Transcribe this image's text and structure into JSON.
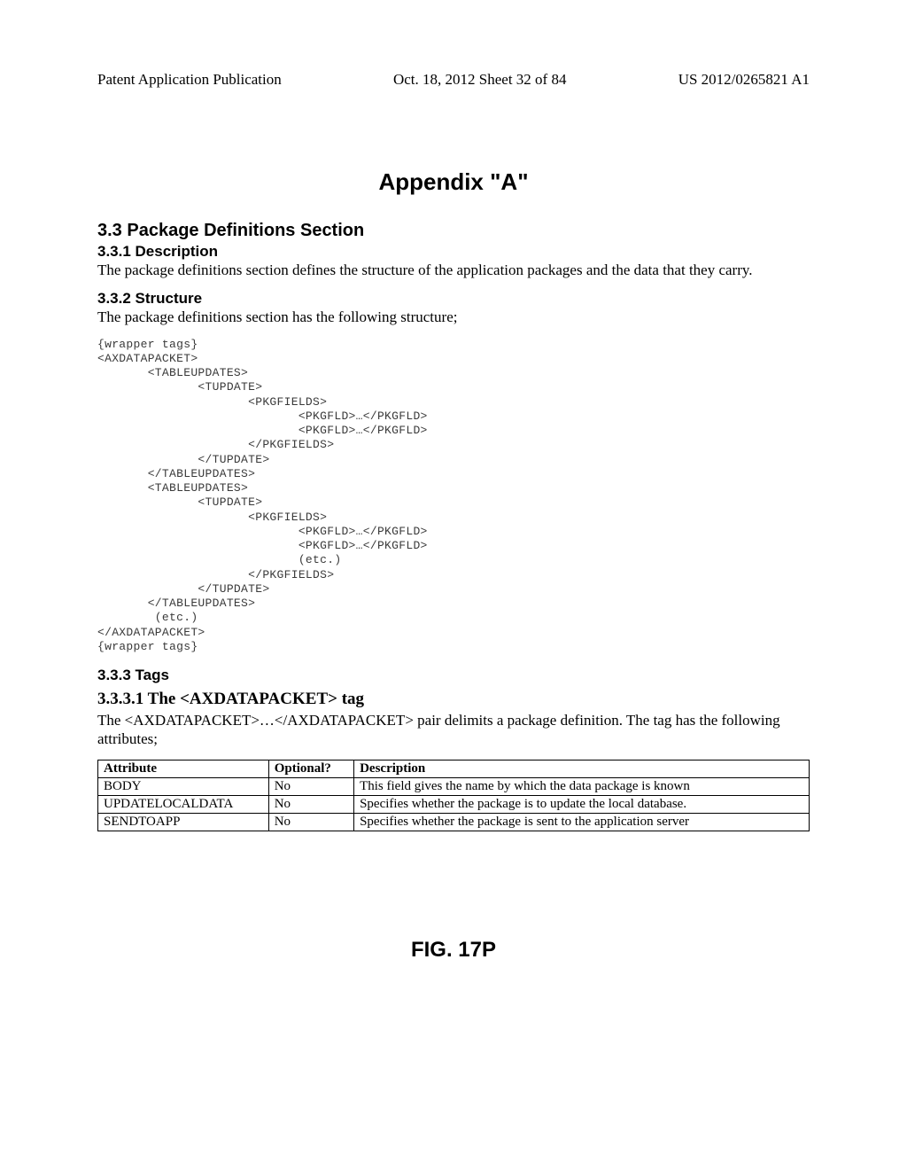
{
  "header": {
    "left": "Patent Application Publication",
    "middle": "Oct. 18, 2012  Sheet 32 of 84",
    "right": "US 2012/0265821 A1"
  },
  "appendix_title": "Appendix \"A\"",
  "section33_heading": "3.3  Package Definitions Section",
  "section331_heading": "3.3.1  Description",
  "section331_body": "The package definitions section defines the structure of the application packages and the data that they carry.",
  "section332_heading": "3.3.2  Structure",
  "section332_body": "The package definitions section has the following structure;",
  "code_block": "{wrapper tags}\n<AXDATAPACKET>\n       <TABLEUPDATES>\n              <TUPDATE>\n                     <PKGFIELDS>\n                            <PKGFLD>…</PKGFLD>\n                            <PKGFLD>…</PKGFLD>\n                     </PKGFIELDS>\n              </TUPDATE>\n       </TABLEUPDATES>\n       <TABLEUPDATES>\n              <TUPDATE>\n                     <PKGFIELDS>\n                            <PKGFLD>…</PKGFLD>\n                            <PKGFLD>…</PKGFLD>\n                            (etc.)\n                     </PKGFIELDS>\n              </TUPDATE>\n       </TABLEUPDATES>\n        (etc.)\n</AXDATAPACKET>\n{wrapper tags}",
  "section333_heading": "3.3.3  Tags",
  "section3331_heading": "3.3.3.1  The <AXDATAPACKET> tag",
  "section3331_body": "The <AXDATAPACKET>…</AXDATAPACKET> pair delimits a package definition. The tag has the following attributes;",
  "table": {
    "headers": {
      "attr": "Attribute",
      "opt": "Optional?",
      "desc": "Description"
    },
    "rows": [
      {
        "attr": "BODY",
        "opt": "No",
        "desc": "This field gives the name by which the data package is known"
      },
      {
        "attr": "UPDATELOCALDATA",
        "opt": "No",
        "desc": "Specifies whether the package is to update the local database."
      },
      {
        "attr": "SENDTOAPP",
        "opt": "No",
        "desc": "Specifies whether the package is sent to the application server"
      }
    ]
  },
  "figure_label": "FIG. 17P"
}
